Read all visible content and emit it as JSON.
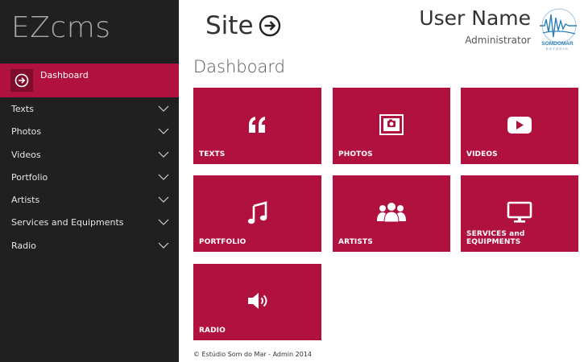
{
  "sidebar": {
    "brand": "EZcms",
    "active_item": "Dashboard",
    "items": [
      {
        "label": "Texts"
      },
      {
        "label": "Photos"
      },
      {
        "label": "Videos"
      },
      {
        "label": "Portfolio"
      },
      {
        "label": "Artists"
      },
      {
        "label": "Services and Equipments"
      },
      {
        "label": "Radio"
      }
    ]
  },
  "header": {
    "site_title": "Site",
    "user_name": "User Name",
    "user_role": "Administrator",
    "logo_text": "SOMDOMAR",
    "logo_subtext": "ESTÚDIO"
  },
  "main": {
    "page_title": "Dashboard",
    "tiles": [
      {
        "label": "TEXTS",
        "icon": "quote-icon"
      },
      {
        "label": "PHOTOS",
        "icon": "photos-icon"
      },
      {
        "label": "VIDEOS",
        "icon": "play-icon"
      },
      {
        "label": "PORTFOLIO",
        "icon": "music-note-icon"
      },
      {
        "label": "ARTISTS",
        "icon": "users-icon"
      },
      {
        "label": "SERVICES and EQUIPMENTS",
        "icon": "monitor-icon"
      },
      {
        "label": "RADIO",
        "icon": "speaker-icon"
      }
    ]
  },
  "footer": "© Estúdio Som do Mar - Admin 2014",
  "colors": {
    "accent": "#b0113f",
    "sidebar_bg": "#202020",
    "active_icon_bg": "#7d0c2d",
    "logo_blue": "#2c7fb8"
  }
}
